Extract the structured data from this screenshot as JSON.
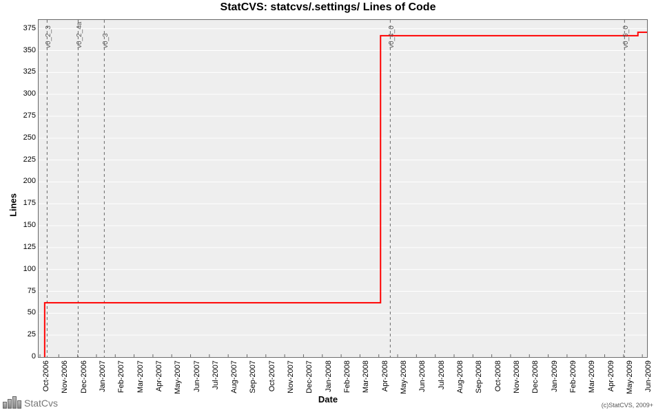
{
  "chart_data": {
    "type": "line",
    "title": "StatCVS: statcvs/.settings/ Lines of Code",
    "xlabel": "Date",
    "ylabel": "Lines",
    "ylim": [
      0,
      385
    ],
    "y_ticks": [
      0,
      25,
      50,
      75,
      100,
      125,
      150,
      175,
      200,
      225,
      250,
      275,
      300,
      325,
      350,
      375
    ],
    "x_categories": [
      "Oct-2006",
      "Nov-2006",
      "Dec-2006",
      "Jan-2007",
      "Feb-2007",
      "Mar-2007",
      "Apr-2007",
      "May-2007",
      "Jun-2007",
      "Jul-2007",
      "Aug-2007",
      "Sep-2007",
      "Oct-2007",
      "Nov-2007",
      "Dec-2007",
      "Jan-2008",
      "Feb-2008",
      "Mar-2008",
      "Apr-2008",
      "May-2008",
      "Jun-2008",
      "Jul-2008",
      "Aug-2008",
      "Sep-2008",
      "Oct-2008",
      "Nov-2008",
      "Dec-2008",
      "Jan-2009",
      "Feb-2009",
      "Mar-2009",
      "Apr-2009",
      "May-2009",
      "Jun-2009"
    ],
    "series": [
      {
        "name": "Lines of Code",
        "color": "#ff0000",
        "points": [
          {
            "x": "Oct-2006",
            "x_frac": 0.01,
            "y": 0
          },
          {
            "x": "Oct-2006",
            "x_frac": 0.01,
            "y": 62
          },
          {
            "x": "Apr-2008",
            "x_frac": 0.562,
            "y": 62
          },
          {
            "x": "Apr-2008",
            "x_frac": 0.562,
            "y": 367
          },
          {
            "x": "Jun-2009",
            "x_frac": 0.985,
            "y": 367
          },
          {
            "x": "Jun-2009",
            "x_frac": 0.985,
            "y": 371
          },
          {
            "x": "Jun-2009",
            "x_frac": 1.0,
            "y": 371
          }
        ]
      }
    ],
    "reference_lines": [
      {
        "label": "v0_2_3",
        "x_frac": 0.014
      },
      {
        "label": "v0_2_4a",
        "x_frac": 0.065
      },
      {
        "label": "v0_3",
        "x_frac": 0.108
      },
      {
        "label": "v0_4_0",
        "x_frac": 0.578
      },
      {
        "label": "v0_5_0",
        "x_frac": 0.963
      }
    ]
  },
  "footer": {
    "brand": "StatCvs",
    "copyright": "(c)StatCVS, 2009+"
  }
}
